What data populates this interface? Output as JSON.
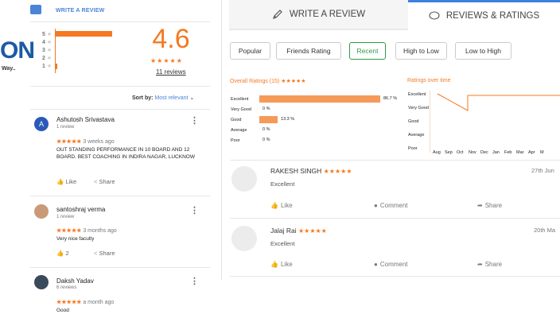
{
  "brand": {
    "logo_text": "ON",
    "tagline": "Way.."
  },
  "left": {
    "write_review": "WRITE A REVIEW",
    "star_labels": [
      "5",
      "4",
      "3",
      "2",
      "1"
    ],
    "star_fractions": [
      1.0,
      0.0,
      0.0,
      0.0,
      0.04
    ],
    "rating": "4.6",
    "stars": "★★★★★",
    "reviews_link": "11 reviews",
    "sort_label": "Sort by:",
    "sort_value": "Most relevant",
    "reviews": [
      {
        "initial": "A",
        "name": "Ashutosh Srivastava",
        "count": "1 review",
        "stars": "★★★★★",
        "time": "3 weeks ago",
        "text": "OUT STANDING PERFORMANCE IN 10 BOARD AND 12 BOARD.  BEST COACHING IN INDIRA NAGAR, LUCKNOW",
        "like": "Like",
        "share": "Share"
      },
      {
        "name": "santoshraj verma",
        "count": "1 review",
        "stars": "★★★★★",
        "time": "3 months ago",
        "text": "Very nice faculty",
        "like": "2",
        "share": "Share"
      },
      {
        "name": "Daksh Yadav",
        "count": "6 reviews",
        "stars": "★★★★★",
        "time": "a month ago",
        "text": "Good"
      }
    ]
  },
  "tabs": {
    "write": "WRITE A REVIEW",
    "reviews": "REVIEWS & RATINGS"
  },
  "filters": [
    "Popular",
    "Friends Rating",
    "Recent",
    "High to Low",
    "Low to High"
  ],
  "overall": {
    "title": "Overall Ratings (15) ★★★★★",
    "rows": [
      {
        "label": "Excellent",
        "pct": "86.7 %",
        "value": 86.7
      },
      {
        "label": "Very Good",
        "pct": "0 %",
        "value": 0
      },
      {
        "label": "Good",
        "pct": "13.3 %",
        "value": 13.3
      },
      {
        "label": "Average",
        "pct": "0 %",
        "value": 0
      },
      {
        "label": "Poor",
        "pct": "0 %",
        "value": 0
      }
    ]
  },
  "over_time": {
    "title": "Ratings over time",
    "ylabels": [
      "Excellent",
      "Very Good",
      "Good",
      "Average",
      "Poor"
    ],
    "months": [
      "Aug",
      "Sep",
      "Oct",
      "Nov",
      "Dec",
      "Jan",
      "Feb",
      "Mar",
      "Apr",
      "M"
    ]
  },
  "posts": [
    {
      "name": "RAKESH SINGH",
      "stars": "★★★★★",
      "rating_text": "Excellent",
      "date": "27th Jun",
      "like": "Like",
      "comment": "Comment",
      "share": "Share"
    },
    {
      "name": "Jalaj Rai",
      "stars": "★★★★★",
      "rating_text": "Excellent",
      "date": "20th Ma",
      "like": "Like",
      "comment": "Comment",
      "share": "Share"
    }
  ],
  "colors": {
    "accent": "#f47920",
    "blue": "#3d80e0",
    "green": "#2d9a4a"
  }
}
